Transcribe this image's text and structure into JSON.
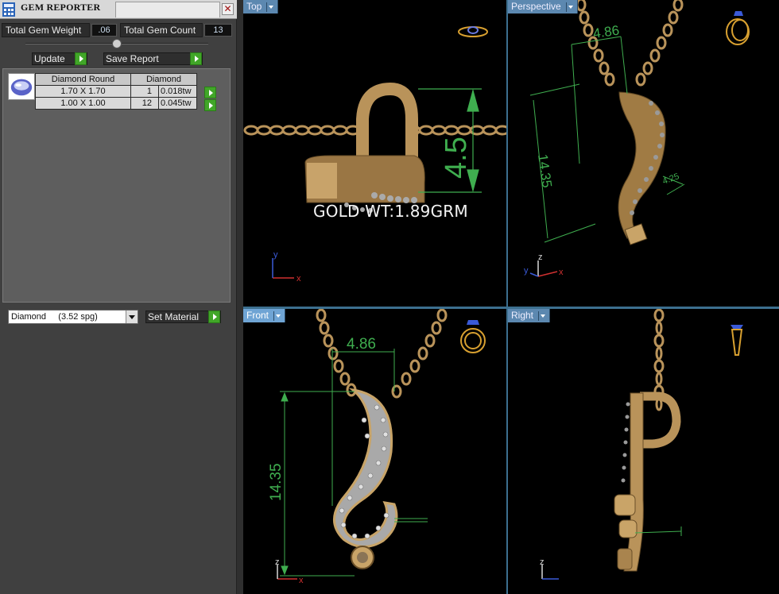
{
  "window": {
    "title": "GEM REPORTER"
  },
  "stats": {
    "total_weight_label": "Total Gem Weight",
    "total_weight_value": ".06",
    "total_count_label": "Total Gem Count",
    "total_count_value": "13"
  },
  "buttons": {
    "update": "Update",
    "save_report": "Save Report",
    "set_material": "Set Material"
  },
  "gem_table": {
    "headers": [
      "Diamond Round",
      "Diamond"
    ],
    "rows": [
      {
        "size": "1.70 X 1.70",
        "count": "1",
        "weight": "0.018tw"
      },
      {
        "size": "1.00 X 1.00",
        "count": "12",
        "weight": "0.045tw"
      }
    ]
  },
  "material": {
    "selected": "Diamond     (3.52 spg)"
  },
  "viewports": {
    "top": {
      "label": "Top",
      "dimension": "4.5",
      "gold_weight": "GOLD WT:1.89GRM"
    },
    "perspective": {
      "label": "Perspective",
      "dim_width": "4.86",
      "dim_height": "14.35",
      "dim_small": "4.25"
    },
    "front": {
      "label": "Front",
      "dim_width": "4.86",
      "dim_height": "14.35"
    },
    "right": {
      "label": "Right"
    }
  },
  "axes": {
    "x": "x",
    "y": "y",
    "z": "z"
  },
  "colors": {
    "gold": "#b9935a",
    "gold_dark": "#7e6036",
    "silver": "#a8a8a8",
    "dim_green": "#3fae4f",
    "axis_red": "#d03030",
    "axis_blue": "#3a5ad8",
    "viewport_border": "#3c6f8f"
  }
}
